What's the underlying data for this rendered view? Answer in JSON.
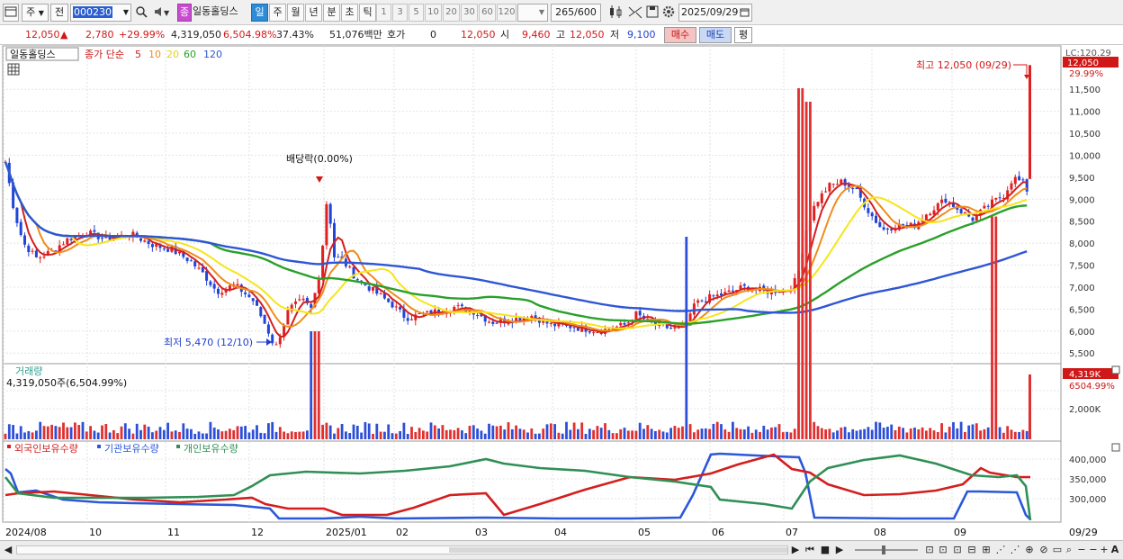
{
  "toolbar": {
    "market": "주",
    "prev_label": "전",
    "code": "000230",
    "name_badge": "종",
    "stock_name": "일동홀딩스",
    "periods": [
      "일",
      "주",
      "월",
      "년",
      "분",
      "초",
      "틱"
    ],
    "selected_period": "일",
    "intervals": [
      "1",
      "3",
      "5",
      "10",
      "20",
      "30",
      "60",
      "120"
    ],
    "count": "265",
    "max_count": "/600",
    "date": "2025/09/29"
  },
  "quote": {
    "price": "12,050",
    "change_arrow": "▲",
    "change": "2,780",
    "change_pct": "+29.99%",
    "volume": "4,319,050",
    "volume_pct": "6,504.98%",
    "turnover": "37.43%",
    "amount": "51,076백만",
    "hoga_label": "호가",
    "hoga_value": "0",
    "hoga_price": "12,050",
    "open_label": "시",
    "open": "9,460",
    "high_label": "고",
    "high": "12,050",
    "low_label": "저",
    "low": "9,100",
    "buy_label": "매수",
    "sell_label": "매도",
    "avg_label": "평"
  },
  "price_panel": {
    "legend_name": "일동홀딩스",
    "legend_ma_title": "종가 단순",
    "ma_periods": [
      "5",
      "10",
      "20",
      "60",
      "120"
    ],
    "ma_colors": [
      "#d42020",
      "#f08c1a",
      "#f6e51a",
      "#2aa02a",
      "#2f56d6"
    ],
    "high_annotation": "최고 12,050 (09/29)",
    "low_annotation": "최저 5,470 (12/10)",
    "dividend_annotation": "배당락(0.00%)",
    "last_price_tag": "12,050",
    "lc_label": "LC:120.29",
    "pct_label": "29.99%",
    "y_ticks": [
      "11,500",
      "11,000",
      "10,500",
      "10,000",
      "9,500",
      "9,000",
      "8,500",
      "8,000",
      "7,500",
      "7,000",
      "6,500",
      "6,000",
      "5,500"
    ]
  },
  "volume_panel": {
    "title": "거래량",
    "value_text": "4,319,050주(6,504.99%)",
    "last_tag": "4,319K",
    "pct_tag": "6504.99%",
    "y_ticks": [
      "2,000K"
    ]
  },
  "holdings_panel": {
    "legend": [
      "외국인보유수량",
      "기관보유수량",
      "개인보유수량"
    ],
    "colors": [
      "#d41e1e",
      "#2b57d9",
      "#2f8f55"
    ],
    "y_ticks": [
      "400,000",
      "350,000",
      "300,000"
    ]
  },
  "x_axis": {
    "labels": [
      "2024/08",
      "10",
      "11",
      "12",
      "2025/01",
      "02",
      "03",
      "04",
      "05",
      "06",
      "07",
      "08",
      "09"
    ],
    "end_label": "09/29"
  }
}
